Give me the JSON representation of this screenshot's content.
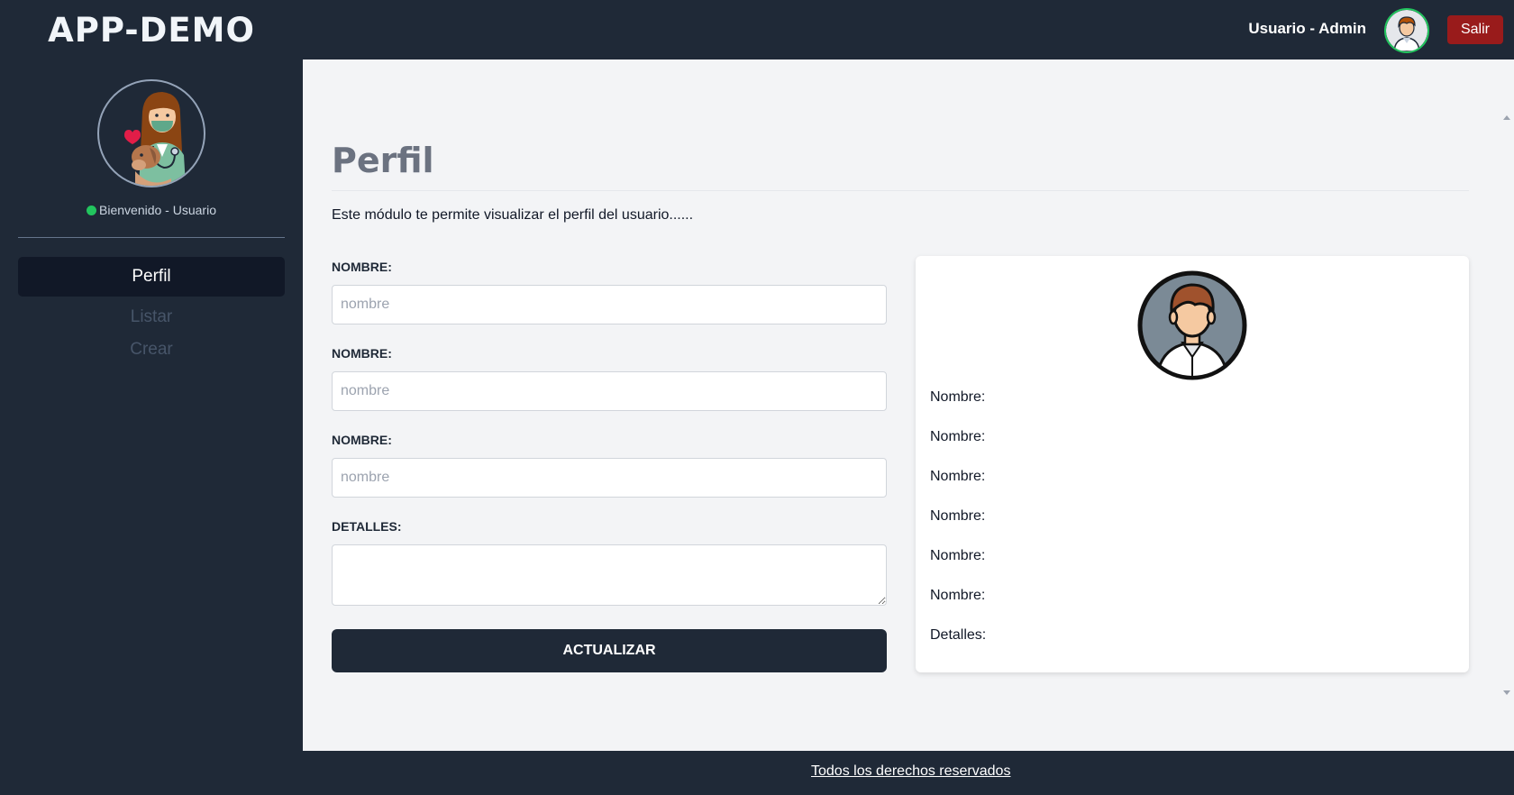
{
  "app": {
    "brand": "APP-DEMO"
  },
  "sidebar": {
    "welcome": "Bienvenido - Usuario",
    "items": [
      {
        "label": "Perfil",
        "active": true
      },
      {
        "label": "Listar",
        "active": false
      },
      {
        "label": "Crear",
        "active": false
      }
    ]
  },
  "header": {
    "user_label": "Usuario - Admin",
    "logout_label": "Salir"
  },
  "main": {
    "title": "Perfil",
    "description": "Este módulo te permite visualizar el perfil del usuario......",
    "form": {
      "fields": [
        {
          "label": "NOMBRE:",
          "placeholder": "nombre",
          "value": ""
        },
        {
          "label": "NOMBRE:",
          "placeholder": "nombre",
          "value": ""
        },
        {
          "label": "NOMBRE:",
          "placeholder": "nombre",
          "value": ""
        }
      ],
      "details_label": "DETALLES:",
      "submit_label": "ACTUALIZAR"
    },
    "card": {
      "rows": [
        "Nombre:",
        "Nombre:",
        "Nombre:",
        "Nombre:",
        "Nombre:",
        "Nombre:",
        "Detalles:"
      ]
    }
  },
  "footer": {
    "link_text": "Todos los derechos reservados"
  },
  "colors": {
    "background": "#1f2937",
    "content": "#f3f4f6",
    "logout": "#991b1b",
    "status_online": "#22c55e"
  },
  "icons": {
    "side_avatar": "vet-woman-with-dog-avatar",
    "header_avatar": "man-avatar",
    "card_avatar": "man-avatar"
  }
}
